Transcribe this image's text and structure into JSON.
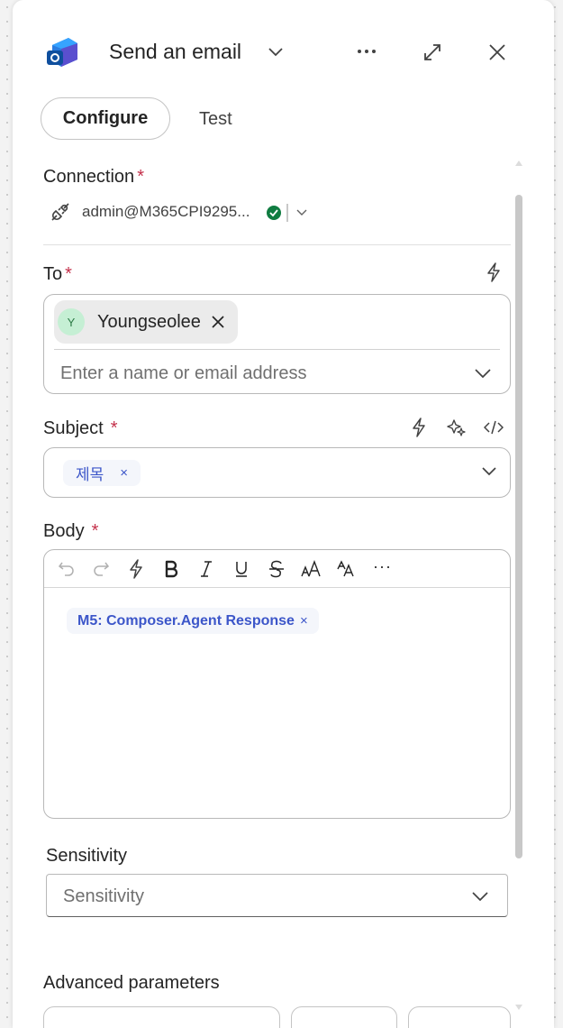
{
  "header": {
    "title": "Send an email",
    "app_icon": "outlook-icon",
    "colors": {
      "outlook_blue": "#1a73d4",
      "outlook_dark": "#0f4f9e"
    }
  },
  "tabs": [
    {
      "label": "Configure",
      "selected": true
    },
    {
      "label": "Test",
      "selected": false
    }
  ],
  "connection": {
    "label": "Connection",
    "required_mark": "*",
    "account": "admin@M365CPI9295...",
    "status_color": "#107c41"
  },
  "to": {
    "label": "To",
    "required_mark": "*",
    "recipient_initial": "Y",
    "recipient_name": "Youngseolee",
    "placeholder": "Enter a name or email address"
  },
  "subject": {
    "label": "Subject",
    "required_mark": "*",
    "token": "제목",
    "token_close": "×"
  },
  "body": {
    "label": "Body",
    "required_mark": "*",
    "toolbar_more": "···",
    "token": "M5: Composer.Agent Response",
    "token_close": "×"
  },
  "sensitivity": {
    "label": "Sensitivity",
    "placeholder": "Sensitivity"
  },
  "advanced": {
    "label": "Advanced parameters"
  },
  "colors": {
    "required": "#c4314b",
    "token_text": "#3c56c9",
    "token_bg": "#f4f6fb",
    "avatar_bg": "#c5efd4"
  }
}
